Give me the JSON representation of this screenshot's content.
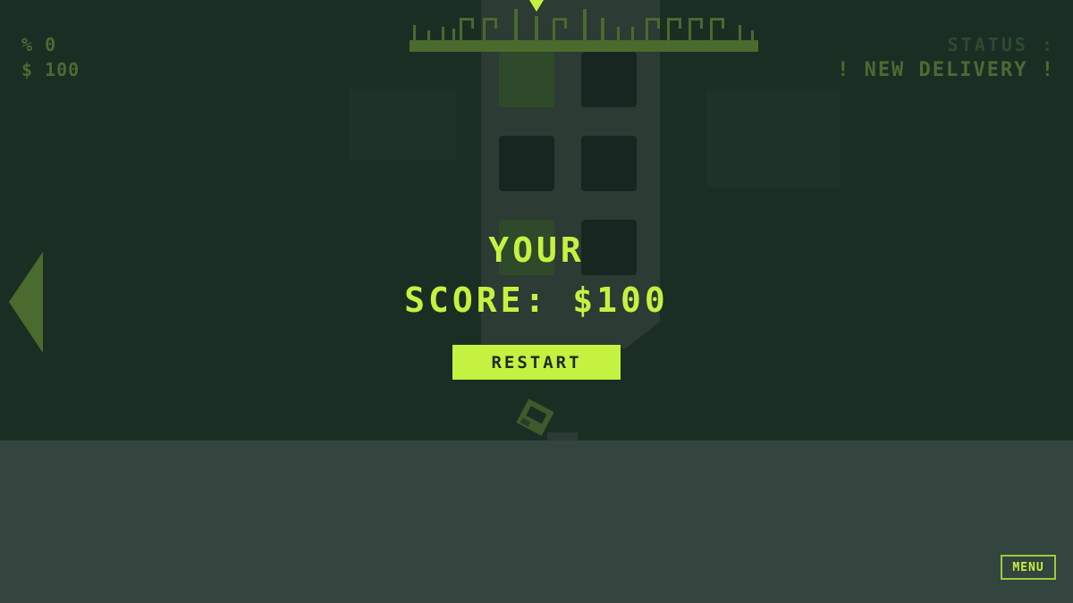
{
  "hud": {
    "percent": "% 0",
    "money": "$ 100"
  },
  "status": {
    "label": "STATUS :",
    "message": "! NEW DELIVERY !"
  },
  "game_over": {
    "line1": "YOUR",
    "line2": "SCORE: $100",
    "restart_label": "RESTART"
  },
  "menu_label": "MENU",
  "colors": {
    "accent": "#c5f241",
    "background": "#1b2e24",
    "ground": "#34443e",
    "building": "#2c3b33",
    "window": "#172620"
  },
  "icons": {
    "left_arrow": "left-arrow-icon",
    "drop_marker": "drop-marker-icon",
    "courier": "courier-character-icon"
  }
}
